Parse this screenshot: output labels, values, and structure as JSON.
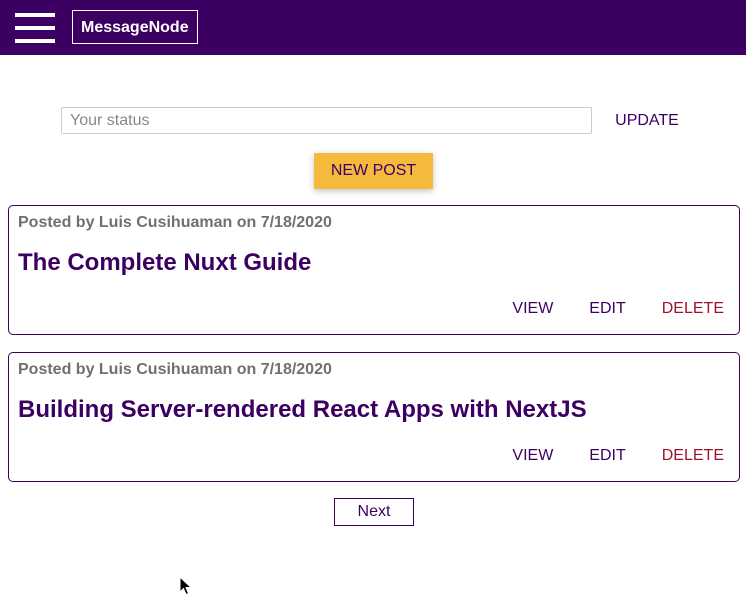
{
  "header": {
    "logo": "MessageNode",
    "menu_icon": "hamburger-menu-icon",
    "background_color": "#3b0062"
  },
  "status": {
    "placeholder": "Your status",
    "value": "",
    "update_label": "UPDATE"
  },
  "new_post_label": "NEW POST",
  "posts": [
    {
      "meta": "Posted by Luis Cusihuaman on 7/18/2020",
      "title": "The Complete Nuxt Guide",
      "view_label": "VIEW",
      "edit_label": "EDIT",
      "delete_label": "DELETE"
    },
    {
      "meta": "Posted by Luis Cusihuaman on 7/18/2020",
      "title": "Building Server-rendered React Apps with NextJS",
      "view_label": "VIEW",
      "edit_label": "EDIT",
      "delete_label": "DELETE"
    }
  ],
  "pagination": {
    "next_label": "Next"
  },
  "colors": {
    "primary": "#3b0062",
    "accent": "#f5ba3d",
    "danger": "#a0122b"
  }
}
